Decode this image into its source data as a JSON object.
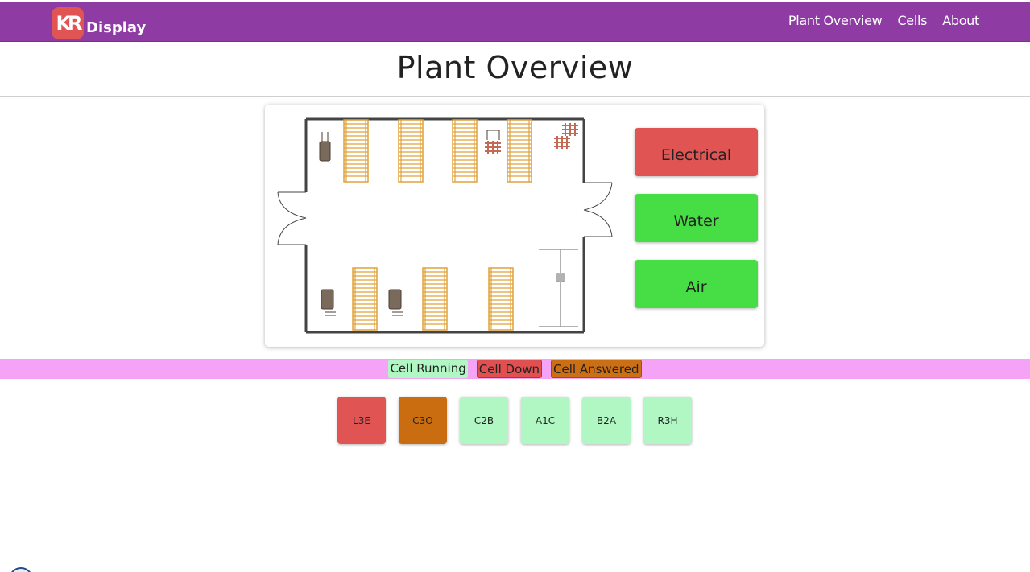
{
  "brand": {
    "logo_mark": "KR",
    "logo_text": "Display"
  },
  "nav": {
    "links": [
      "Plant Overview",
      "Cells",
      "About"
    ]
  },
  "page": {
    "title": "Plant Overview"
  },
  "utilities": [
    {
      "label": "Electrical",
      "status": "down",
      "color": "#e05454"
    },
    {
      "label": "Water",
      "status": "running",
      "color": "#47dd45"
    },
    {
      "label": "Air",
      "status": "running",
      "color": "#47dd45"
    }
  ],
  "legend": {
    "running": "Cell Running",
    "down": "Cell Down",
    "answered": "Cell Answered"
  },
  "status_colors": {
    "running": "#b1f7c3",
    "down": "#e05454",
    "answered": "#c96d10"
  },
  "cells": [
    {
      "label": "L3E",
      "status": "down"
    },
    {
      "label": "C3O",
      "status": "answered"
    },
    {
      "label": "C2B",
      "status": "running"
    },
    {
      "label": "A1C",
      "status": "running"
    },
    {
      "label": "B2A",
      "status": "running"
    },
    {
      "label": "R3H",
      "status": "running"
    }
  ],
  "colors": {
    "navbar": "#8e3ca4",
    "legend_bar": "#f4a3f7"
  }
}
